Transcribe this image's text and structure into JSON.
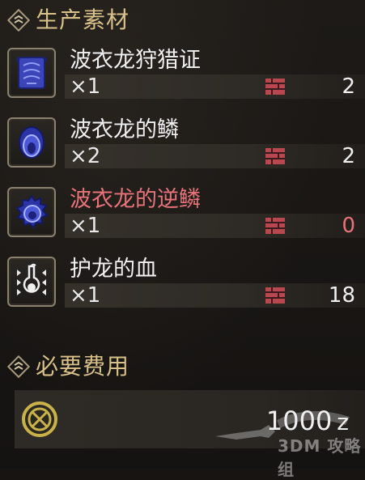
{
  "materials_section": {
    "title": "生产素材",
    "icon": "diamond-arrows-icon",
    "items": [
      {
        "name": "波衣龙狩猎证",
        "icon": "certificate-icon",
        "required": "×1",
        "owned": "2",
        "insufficient": false
      },
      {
        "name": "波衣龙的鳞",
        "icon": "scale-icon",
        "required": "×2",
        "owned": "2",
        "insufficient": false
      },
      {
        "name": "波衣龙的逆鳞",
        "icon": "reverse-scale-icon",
        "required": "×1",
        "owned": "0",
        "insufficient": true
      },
      {
        "name": "护龙的血",
        "icon": "blood-flask-icon",
        "required": "×1",
        "owned": "18",
        "insufficient": false
      }
    ]
  },
  "cost_section": {
    "title": "必要费用",
    "icon": "diamond-arrows-icon",
    "amount": "1000",
    "unit": "z",
    "watermark": "3DM 攻略组"
  },
  "colors": {
    "header_gold": "#d8c18a",
    "warning_red": "#e8737a",
    "box_icon_red": "#b8474f",
    "frame_tan": "#8b8170"
  }
}
